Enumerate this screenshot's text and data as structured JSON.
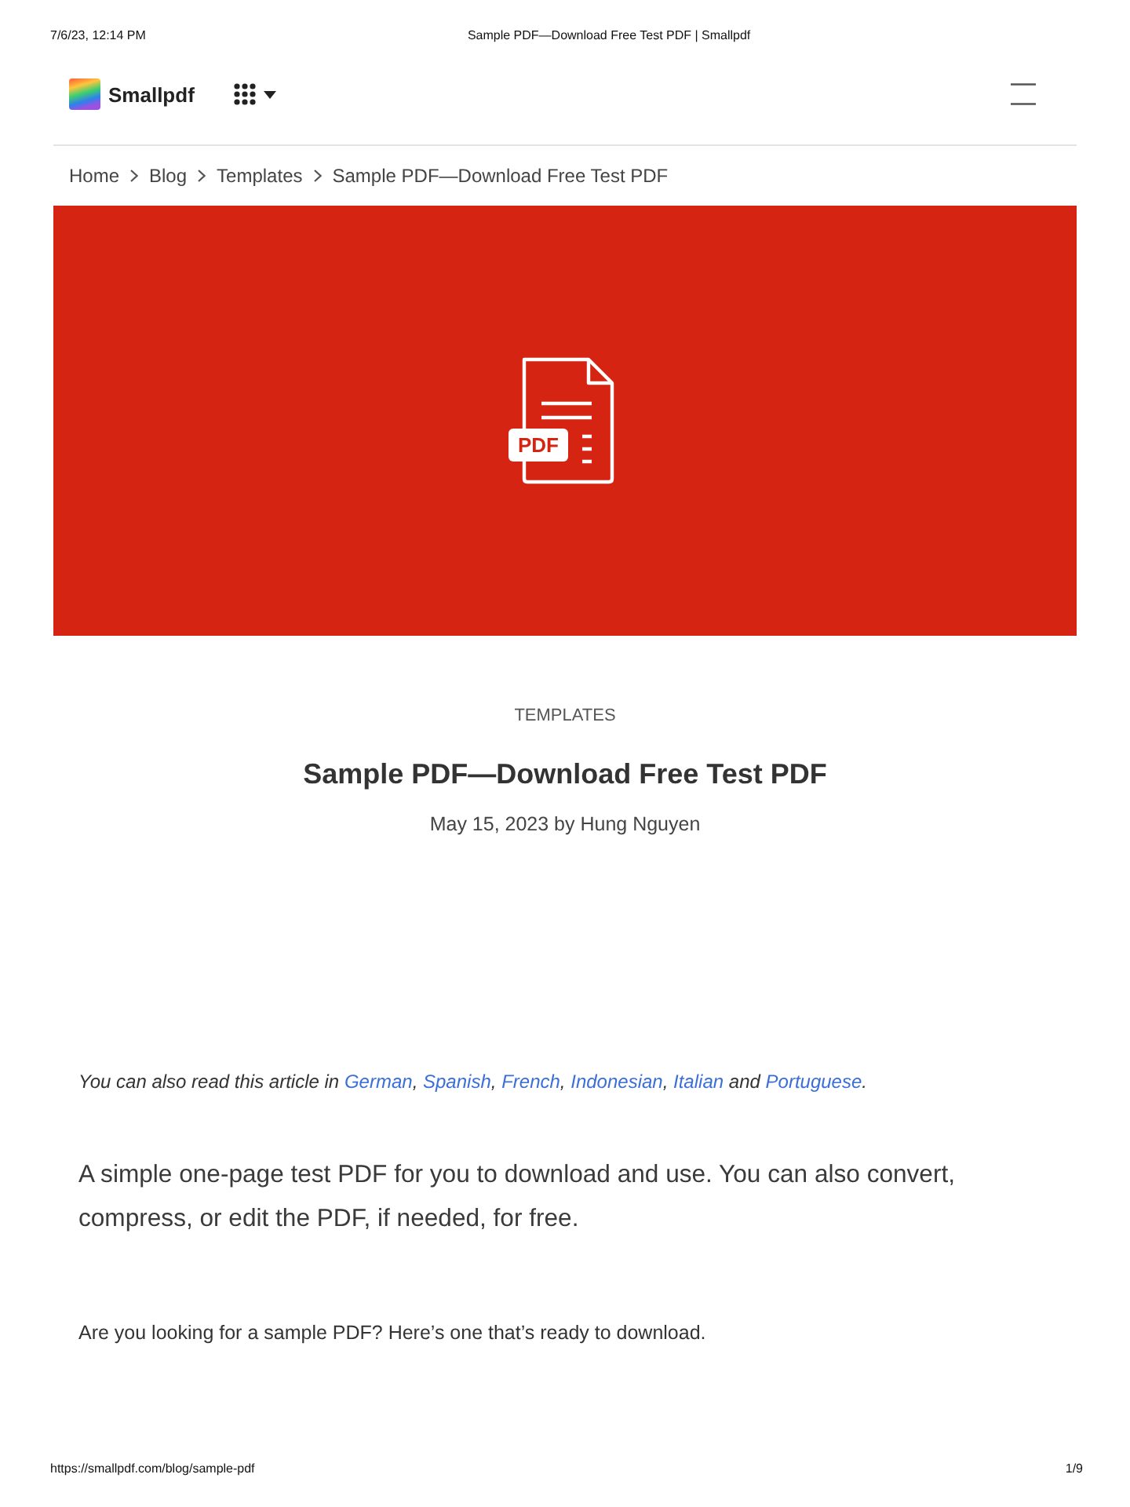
{
  "print_header": {
    "datetime": "7/6/23, 12:14 PM",
    "title": "Sample PDF—Download Free Test PDF | Smallpdf"
  },
  "navbar": {
    "brand": "Smallpdf"
  },
  "breadcrumb": [
    {
      "label": "Home"
    },
    {
      "label": "Blog"
    },
    {
      "label": "Templates"
    },
    {
      "label": "Sample PDF—Download Free Test PDF"
    }
  ],
  "hero": {
    "badge": "PDF"
  },
  "article": {
    "category": "TEMPLATES",
    "title": "Sample PDF—Download Free Test PDF",
    "byline": "May 15, 2023 by Hung Nguyen",
    "language_note": [
      {
        "kind": "text",
        "text": "You can also read this article in"
      },
      {
        "kind": "link",
        "text": "German",
        "punct": ","
      },
      {
        "kind": "link",
        "text": "Spanish",
        "punct": ","
      },
      {
        "kind": "link",
        "text": "French",
        "punct": ","
      },
      {
        "kind": "link",
        "text": "Indonesian",
        "punct": ","
      },
      {
        "kind": "link",
        "text": "Italian"
      },
      {
        "kind": "text",
        "text": "and"
      },
      {
        "kind": "link",
        "text": "Portuguese",
        "punct": "."
      }
    ],
    "lead": "A simple one-page test PDF for you to download and use. You can also convert, compress, or edit the PDF, if needed, for free.",
    "body": [
      "Are you looking for a sample PDF? Here’s one that’s ready to download."
    ]
  },
  "print_footer": {
    "url": "https://smallpdf.com/blog/sample-pdf",
    "page": "1/9"
  }
}
